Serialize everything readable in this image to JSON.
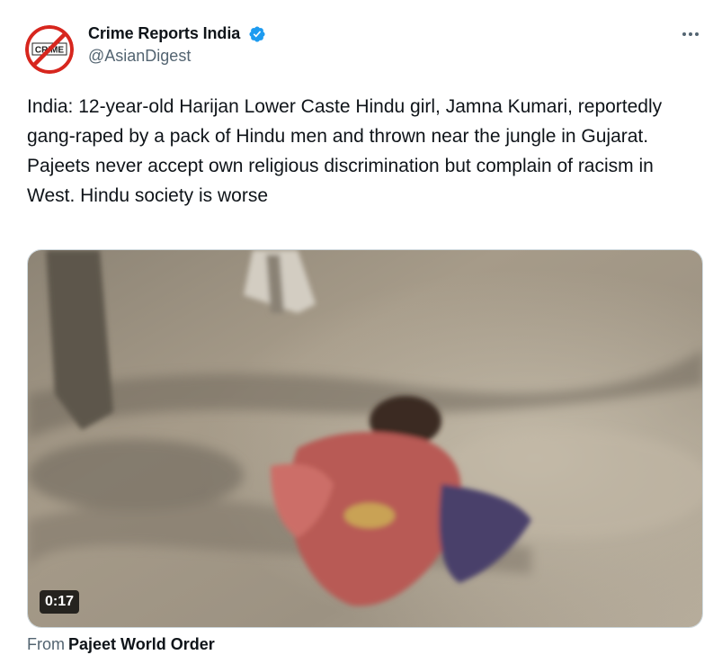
{
  "author": {
    "display_name": "Crime Reports India",
    "handle": "@AsianDigest",
    "avatar_text": "CRIME",
    "verified_icon": "verified-badge-icon",
    "verified_color": "#1d9bf0"
  },
  "tweet": {
    "paragraphs": [
      "India: 12-year-old Harijan Lower Caste Hindu girl, Jamna Kumari, reportedly gang-raped by a pack of Hindu men and thrown near the jungle in Gujarat.",
      "Pajeets never accept own religious discrimination but complain of racism in West. Hindu society is worse"
    ]
  },
  "media": {
    "type": "video",
    "duration": "0:17"
  },
  "attribution": {
    "label": "From",
    "source": "Pajeet World Order"
  },
  "icons": {
    "more": "more-options-icon"
  }
}
